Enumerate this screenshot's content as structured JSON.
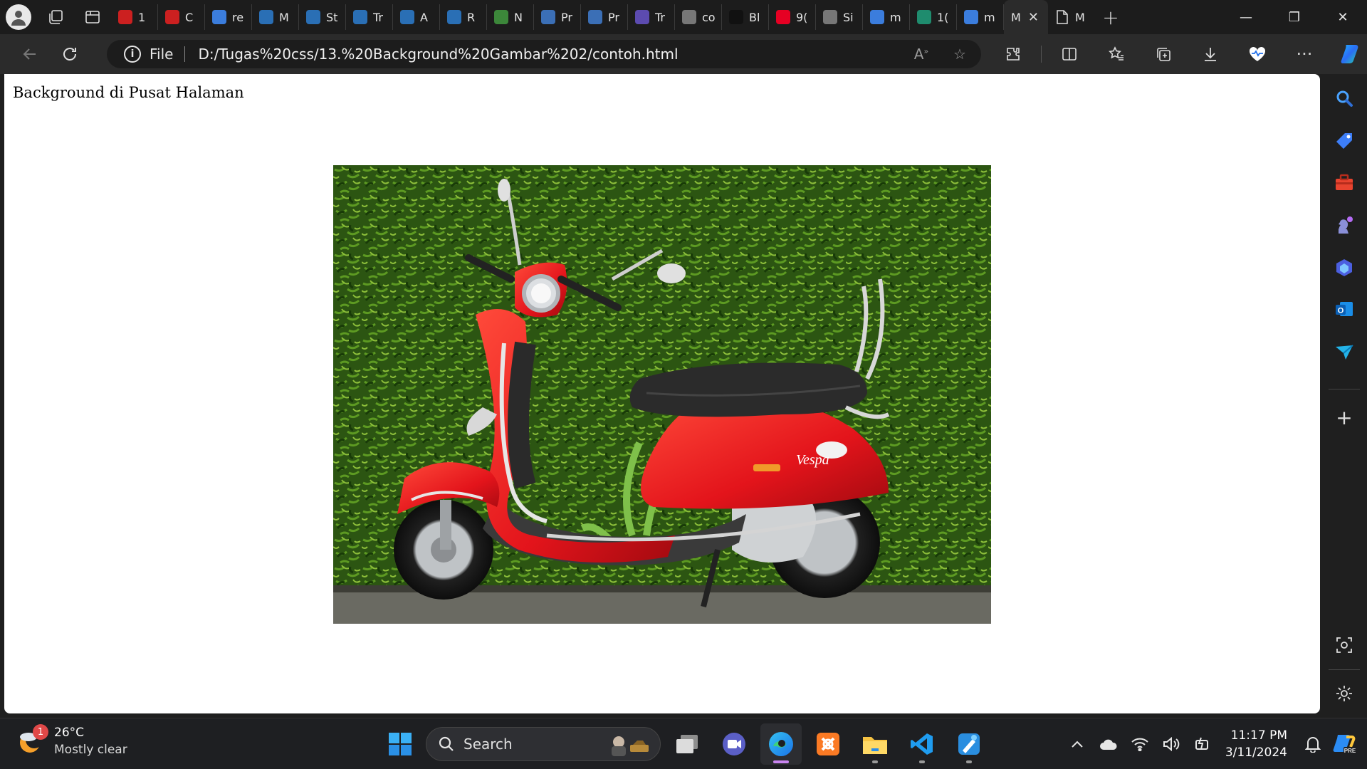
{
  "browser": {
    "tabs": [
      {
        "label": "1",
        "favicon": "youtube-icon",
        "color": "#cc2020"
      },
      {
        "label": "C",
        "favicon": "youtube-icon",
        "color": "#cc2020"
      },
      {
        "label": "re",
        "favicon": "search-icon",
        "color": "#3b7ddd"
      },
      {
        "label": "M",
        "favicon": "react-icon",
        "color": "#2a6fb5"
      },
      {
        "label": "St",
        "favicon": "react-icon",
        "color": "#2a6fb5"
      },
      {
        "label": "Tr",
        "favicon": "react-icon",
        "color": "#2a6fb5"
      },
      {
        "label": "A",
        "favicon": "react-icon",
        "color": "#2a6fb5"
      },
      {
        "label": "R",
        "favicon": "react-icon",
        "color": "#2a6fb5"
      },
      {
        "label": "N",
        "favicon": "node-icon",
        "color": "#3c873a"
      },
      {
        "label": "Pr",
        "favicon": "profile-card-icon",
        "color": "#3b6fb6"
      },
      {
        "label": "Pr",
        "favicon": "doc-icon",
        "color": "#3b6fb6"
      },
      {
        "label": "Tr",
        "favicon": "list-icon",
        "color": "#5c4bb0"
      },
      {
        "label": "co",
        "favicon": "file-icon",
        "color": "#777777"
      },
      {
        "label": "Bl",
        "favicon": "dark-thumb-icon",
        "color": "#111111"
      },
      {
        "label": "9(",
        "favicon": "pinterest-icon",
        "color": "#e60023"
      },
      {
        "label": "Si",
        "favicon": "file-icon",
        "color": "#777777"
      },
      {
        "label": "m",
        "favicon": "search-icon",
        "color": "#3b7ddd"
      },
      {
        "label": "1(",
        "favicon": "p-icon",
        "color": "#1f8c6e"
      },
      {
        "label": "m",
        "favicon": "search-icon",
        "color": "#3b7ddd"
      }
    ],
    "active_tab": {
      "label": "M",
      "close": "✕"
    },
    "extra_tab": {
      "label": "M",
      "favicon": "file-icon"
    },
    "new_tab": "+",
    "window_controls": {
      "minimize": "—",
      "restore": "❐",
      "close": "✕"
    },
    "address": {
      "scheme": "File",
      "url": "D:/Tugas%20css/13.%20Background%20Gambar%202/contoh.html"
    }
  },
  "page": {
    "heading": "Background di Pusat Halaman",
    "image_alt": "red-vespa-scooter-photo"
  },
  "taskbar": {
    "weather": {
      "temp": "26°C",
      "condition": "Mostly clear",
      "badge": "1"
    },
    "search_label": "Search",
    "clock": {
      "time": "11:17 PM",
      "date": "3/11/2024"
    }
  },
  "colors": {
    "accent": "#0078d4",
    "scooter_red": "#e01e1e",
    "hedge_green": "#2f5a14"
  }
}
